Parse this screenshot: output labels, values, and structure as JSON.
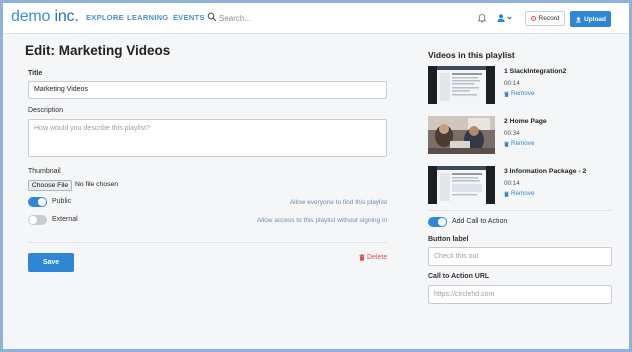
{
  "header": {
    "logo_main": "demo",
    "logo_suffix": " inc.",
    "nav": [
      "EXPLORE",
      "LEARNING",
      "EVENTS"
    ],
    "search_placeholder": "Search...",
    "record_label": "Record",
    "upload_label": "Upload"
  },
  "form": {
    "page_title": "Edit: Marketing Videos",
    "title_label": "Title",
    "title_value": "Marketing Videos",
    "description_label": "Description",
    "description_placeholder": "How would you describe this playlist?",
    "thumbnail_label": "Thumbnail",
    "choose_file_label": "Choose File",
    "file_status": "No file chosen",
    "public_label": "Public",
    "public_on": true,
    "public_hint": "Allow everyone to find this playlist",
    "external_label": "External",
    "external_on": false,
    "external_hint": "Allow access to this playlist without signing in",
    "save_label": "Save",
    "delete_label": "Delete"
  },
  "playlist": {
    "heading": "Videos in this playlist",
    "videos": [
      {
        "title": "1 SlackIntegration2",
        "duration": "00:14",
        "remove_label": "Remove",
        "thumb_icon": "dark-screen-thumbnail"
      },
      {
        "title": "2 Home Page",
        "duration": "00:34",
        "remove_label": "Remove",
        "thumb_icon": "office-photo-thumbnail"
      },
      {
        "title": "3 Information Package - 2",
        "duration": "00:14",
        "remove_label": "Remove",
        "thumb_icon": "dark-screen-thumbnail"
      }
    ],
    "cta_toggle_label": "Add Call to Action",
    "cta_on": true,
    "button_label_heading": "Button label",
    "button_label_placeholder": "Check this out",
    "cta_url_heading": "Call to Action URL",
    "cta_url_placeholder": "https://circlehd.com"
  },
  "colors": {
    "accent": "#2f86d5",
    "logo": "#3d8fd6",
    "danger": "#d9534f",
    "border_frame": "#8fb2db"
  }
}
